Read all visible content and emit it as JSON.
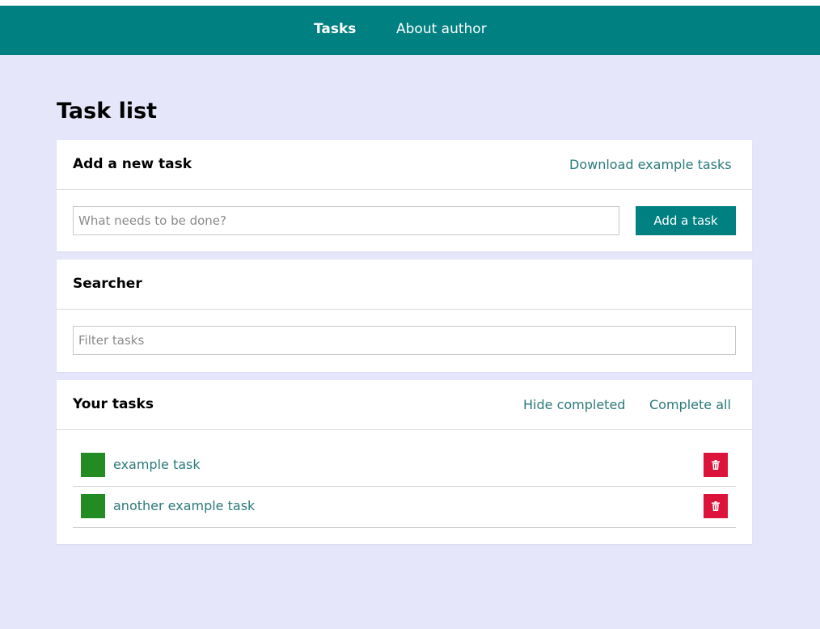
{
  "nav": {
    "items": [
      {
        "label": "Tasks",
        "active": true
      },
      {
        "label": "About author",
        "active": false
      }
    ]
  },
  "page": {
    "title": "Task list"
  },
  "add_card": {
    "title": "Add a new task",
    "download_link": "Download example tasks",
    "input_placeholder": "What needs to be done?",
    "input_value": "",
    "button_label": "Add a task"
  },
  "search_card": {
    "title": "Searcher",
    "input_placeholder": "Filter tasks",
    "input_value": ""
  },
  "tasks_card": {
    "title": "Your tasks",
    "hide_completed_link": "Hide completed",
    "complete_all_link": "Complete all",
    "tasks": [
      {
        "label": "example task",
        "check_icon": "checkbox-square",
        "delete_icon": "trash-icon"
      },
      {
        "label": "another example task",
        "check_icon": "checkbox-square",
        "delete_icon": "trash-icon"
      }
    ]
  },
  "colors": {
    "background": "#e6e6fa",
    "navbar": "#008080",
    "accent": "#008080",
    "link": "#2b7a7a",
    "checkbox": "#228b22",
    "delete": "#dc143c"
  }
}
